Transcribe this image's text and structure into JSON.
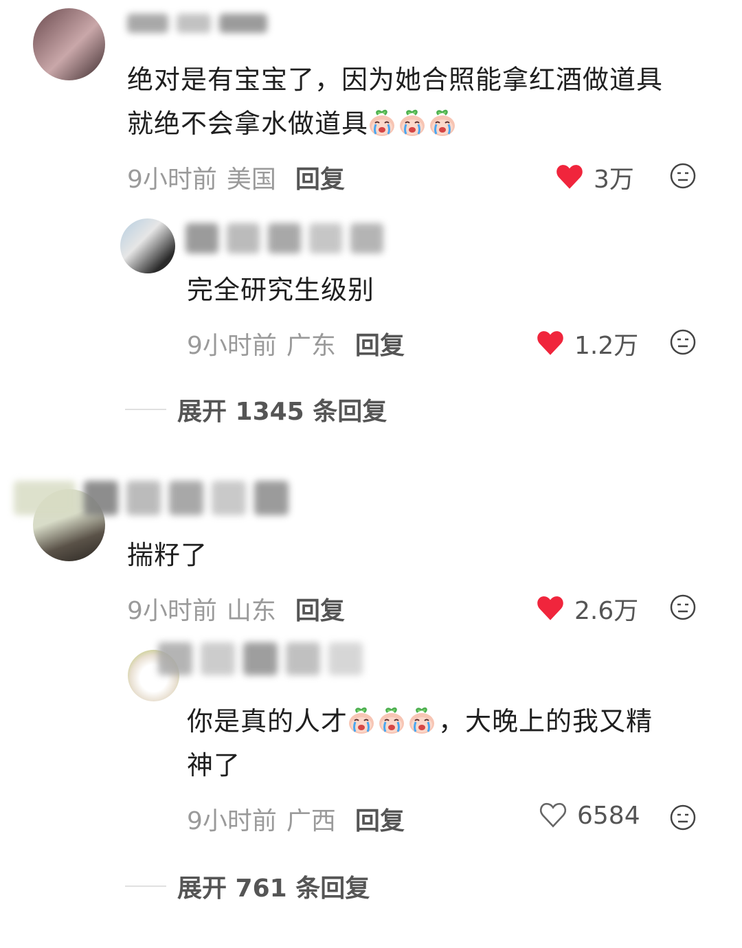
{
  "comments": [
    {
      "text_lines": [
        "绝对是有宝宝了，因为她合照能拿红酒做道具",
        "就绝不会拿水做道具"
      ],
      "time": "9小时前",
      "location": "美国",
      "reply_label": "回复",
      "likes": "3万",
      "liked": true,
      "emoji_name": "crying-peach-emoji"
    },
    {
      "text_lines": [
        "完全研究生级别"
      ],
      "time": "9小时前",
      "location": "广东",
      "reply_label": "回复",
      "likes": "1.2万",
      "liked": true
    },
    {
      "expand_label": "展开 1345 条回复"
    },
    {
      "text_lines": [
        "揣籽了"
      ],
      "time": "9小时前",
      "location": "山东",
      "reply_label": "回复",
      "likes": "2.6万",
      "liked": true
    },
    {
      "text_lines_a": "你是真的人才",
      "text_lines_b": "，大晚上的我又精",
      "text_lines_c": "神了",
      "time": "9小时前",
      "location": "广西",
      "reply_label": "回复",
      "likes": "6584",
      "liked": false
    },
    {
      "expand_label": "展开 761 条回复"
    }
  ],
  "colors": {
    "liked_heart": "#f0253c",
    "text": "#1f1f1f",
    "meta": "#9a9a9a"
  },
  "icons": {
    "like": "heart-icon",
    "dislike": "dislike-face-icon"
  }
}
